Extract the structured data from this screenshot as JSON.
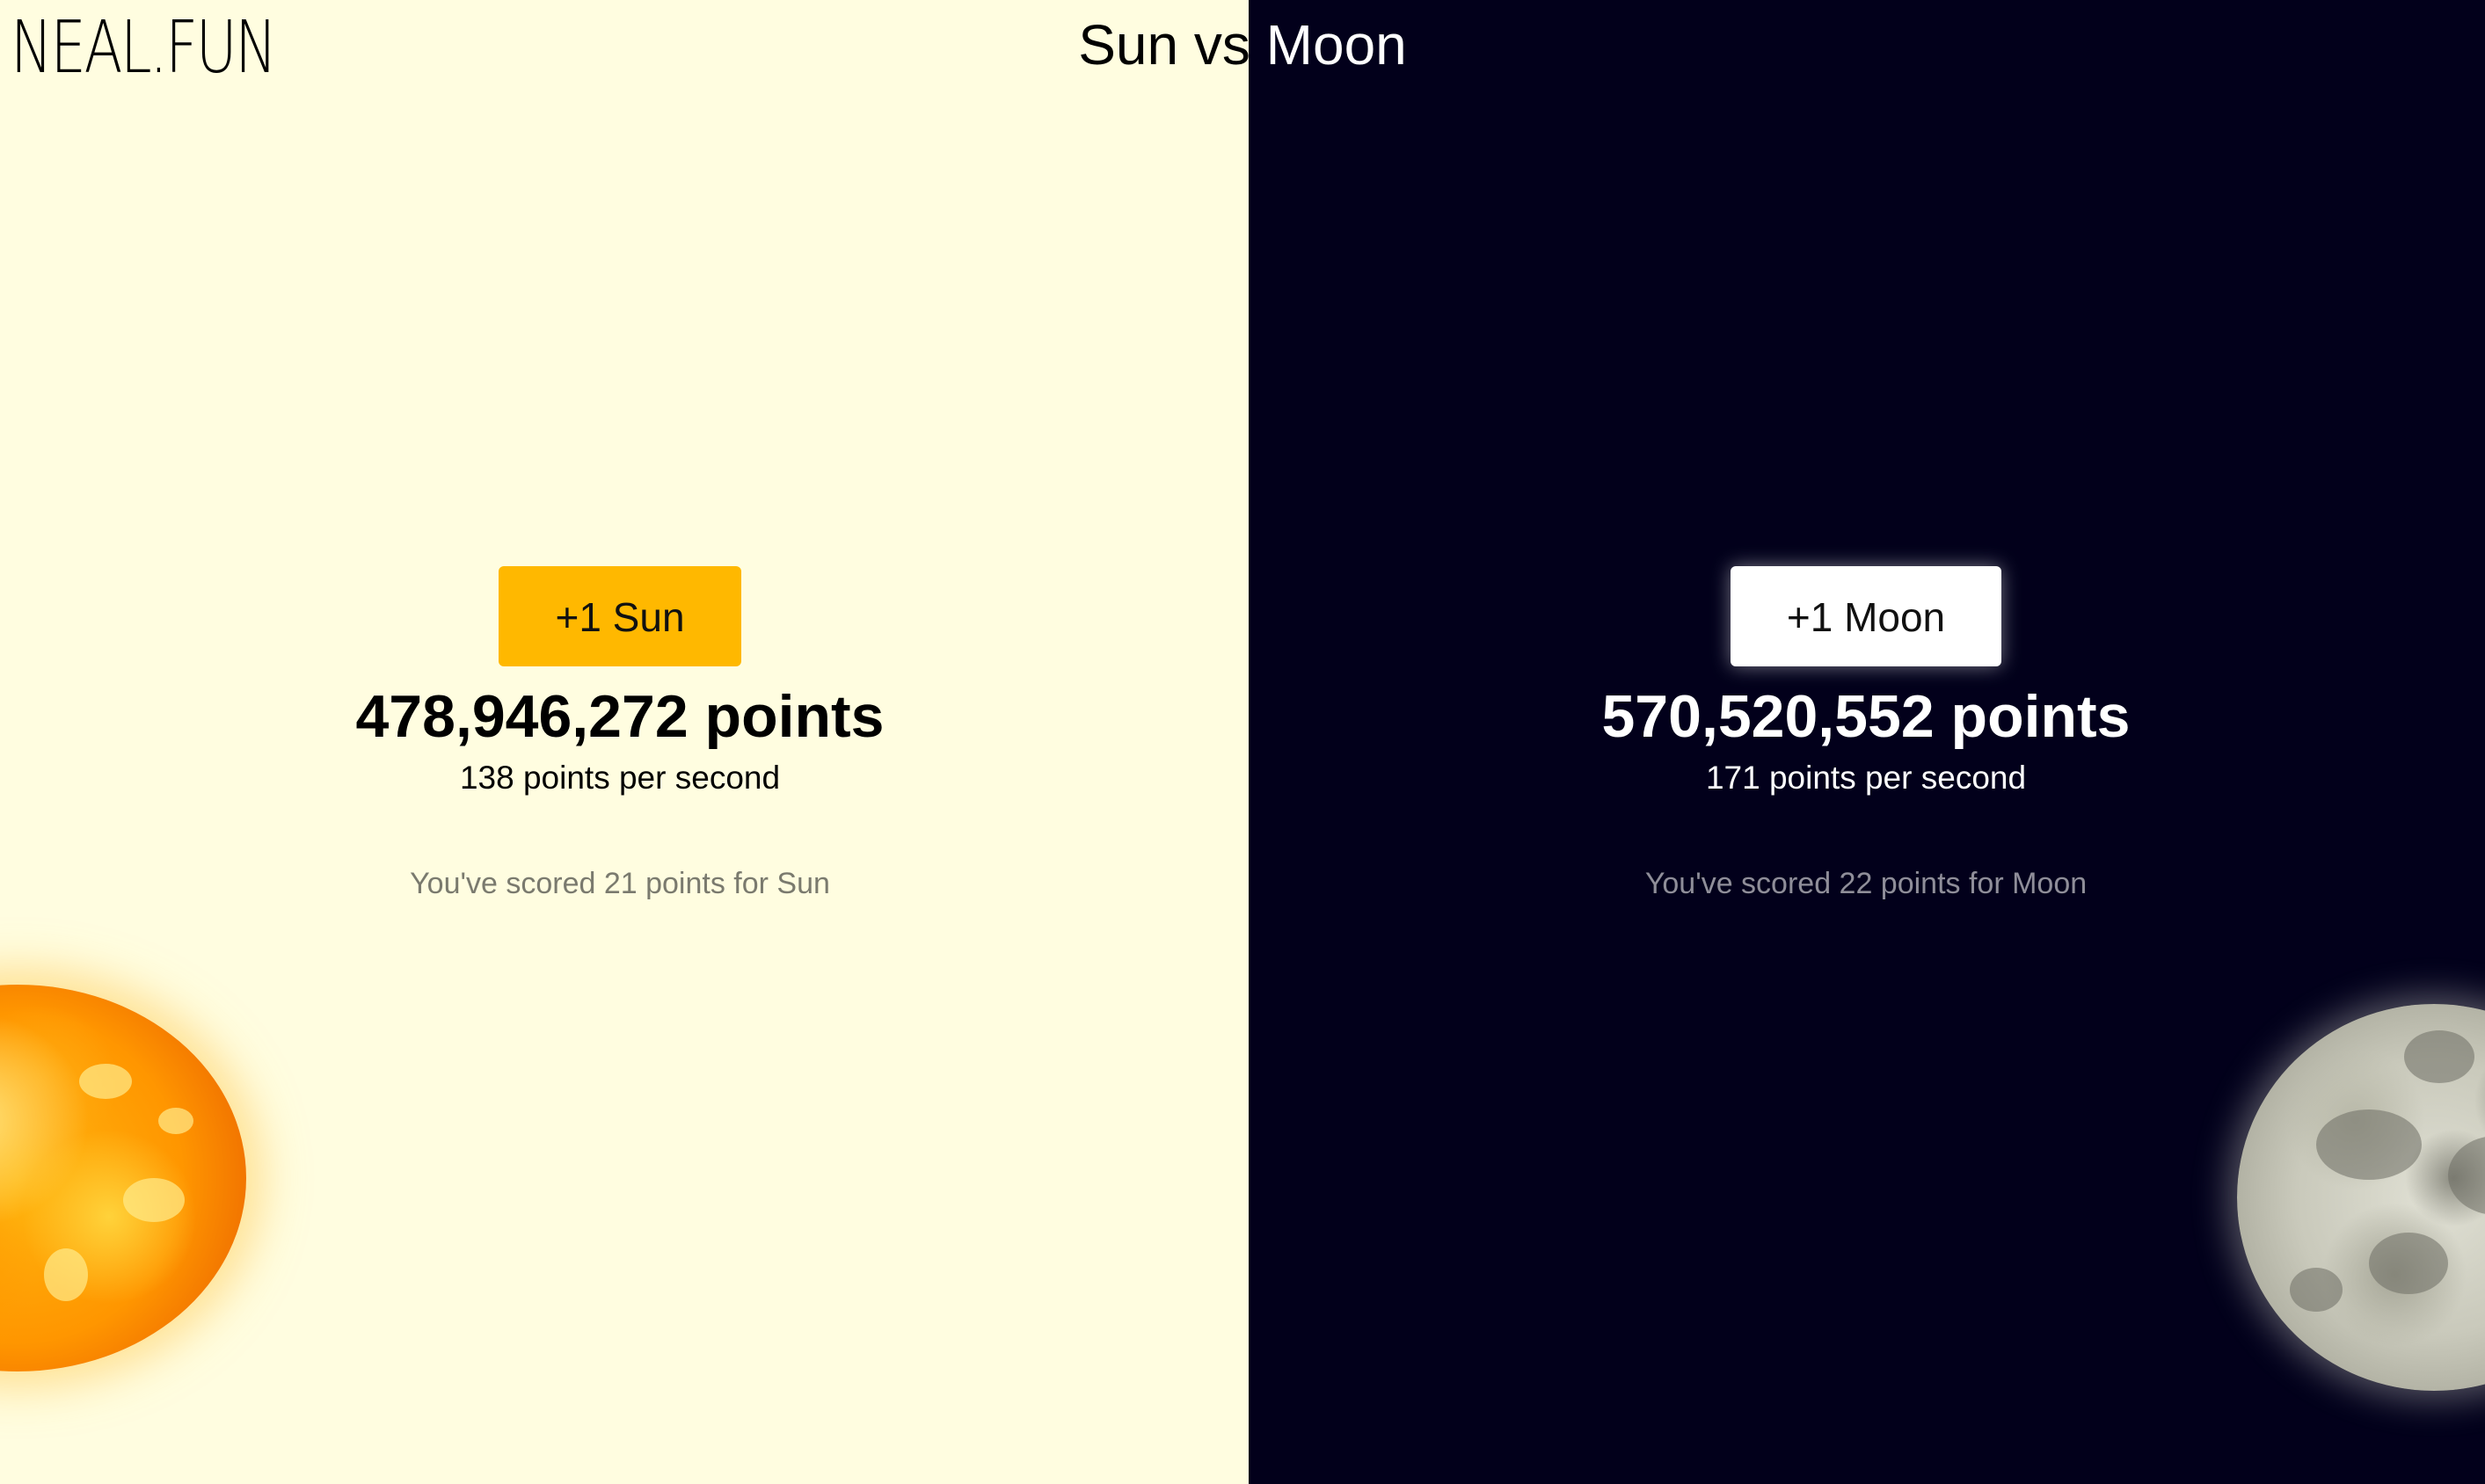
{
  "site": {
    "logo": "NEAL.FUN",
    "title": "Sun vs Moon"
  },
  "sun": {
    "button_label": "+1 Sun",
    "points": "478,946,272 points",
    "rate": "138 points per second",
    "my_score": "You've scored 21 points for Sun",
    "accent_color": "#ffb800",
    "background": "#fffde0"
  },
  "moon": {
    "button_label": "+1 Moon",
    "points": "570,520,552 points",
    "rate": "171 points per second",
    "my_score": "You've scored 22 points for Moon",
    "accent_color": "#ffffff",
    "background": "#02001b"
  },
  "icons": {
    "sun": "sun-image",
    "moon": "moon-image"
  }
}
